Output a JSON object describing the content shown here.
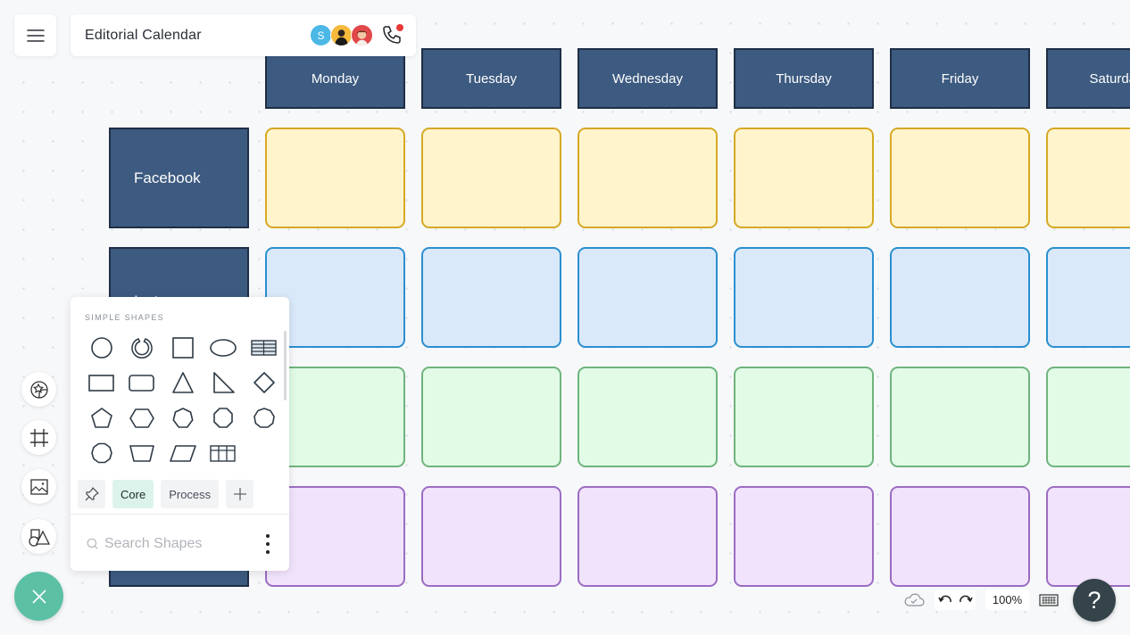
{
  "header": {
    "menu_icon": "hamburger-icon",
    "title": "Editorial Calendar",
    "collaborators": [
      {
        "initial": "S",
        "color": "#4bb8e6"
      },
      {
        "initial": "",
        "color": "#f6b93b"
      },
      {
        "initial": "",
        "color": "#e0484a"
      }
    ],
    "call_icon": "phone-icon"
  },
  "calendar": {
    "days": [
      "Monday",
      "Tuesday",
      "Wednesday",
      "Thursday",
      "Friday",
      "Saturday"
    ],
    "rows": [
      {
        "label": "Facebook",
        "color": "yellow"
      },
      {
        "label": "Inst",
        "color": "blue"
      },
      {
        "label": "",
        "color": "green"
      },
      {
        "label": "",
        "color": "purple"
      }
    ],
    "header_color": "#3d5a80"
  },
  "tool_rail": [
    {
      "name": "sticker-icon"
    },
    {
      "name": "frame-icon"
    },
    {
      "name": "image-icon"
    },
    {
      "name": "shapes-icon"
    }
  ],
  "fab": {
    "icon": "close-icon",
    "color": "#5cc0a5"
  },
  "shape_panel": {
    "heading": "SIMPLE SHAPES",
    "shapes": [
      "circle",
      "donut",
      "square",
      "ellipse",
      "table",
      "rectangle",
      "rounded-rectangle",
      "triangle",
      "right-triangle",
      "diamond",
      "pentagon",
      "hexagon",
      "heptagon",
      "octagon",
      "nonagon",
      "decagon",
      "trapezoid",
      "parallelogram",
      "grid-table"
    ],
    "tabs": [
      {
        "label": "Core",
        "active": true
      },
      {
        "label": "Process",
        "active": false
      }
    ],
    "search_placeholder": "Search Shapes"
  },
  "bottom_bar": {
    "zoom": "100%",
    "help_label": "?"
  }
}
